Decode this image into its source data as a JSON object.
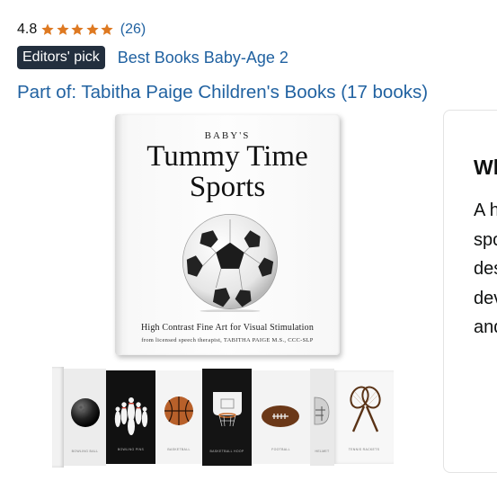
{
  "rating": {
    "value": "4.8",
    "stars": 5,
    "count": "(26)"
  },
  "badge": {
    "label": "Editors' pick",
    "link": "Best Books Baby-Age 2"
  },
  "series": {
    "text": "Part of: Tabitha Paige Children's Books (17 books)"
  },
  "book": {
    "series_label": "BABY'S",
    "title_line1": "Tummy Time",
    "title_line2": "Sports",
    "subtitle": "High Contrast Fine Art for Visual Stimulation",
    "author_line": "from licensed speech therapist, TABITHA PAIGE M.S., CCC-SLP"
  },
  "strip_labels": [
    "BOWLING BALL",
    "BOWLING PINS",
    "BASKETBALL",
    "BASKETBALL HOOP",
    "FOOTBALL",
    "HELMET",
    "TENNIS RACKETS"
  ],
  "side": {
    "heading": "Wh",
    "lines": [
      "A h",
      "spo",
      "des",
      "dev",
      "and"
    ]
  },
  "colors": {
    "star": "#de7921",
    "link": "#2162a1",
    "badge_bg": "#232f3e"
  },
  "icons": [
    "star-icon"
  ]
}
